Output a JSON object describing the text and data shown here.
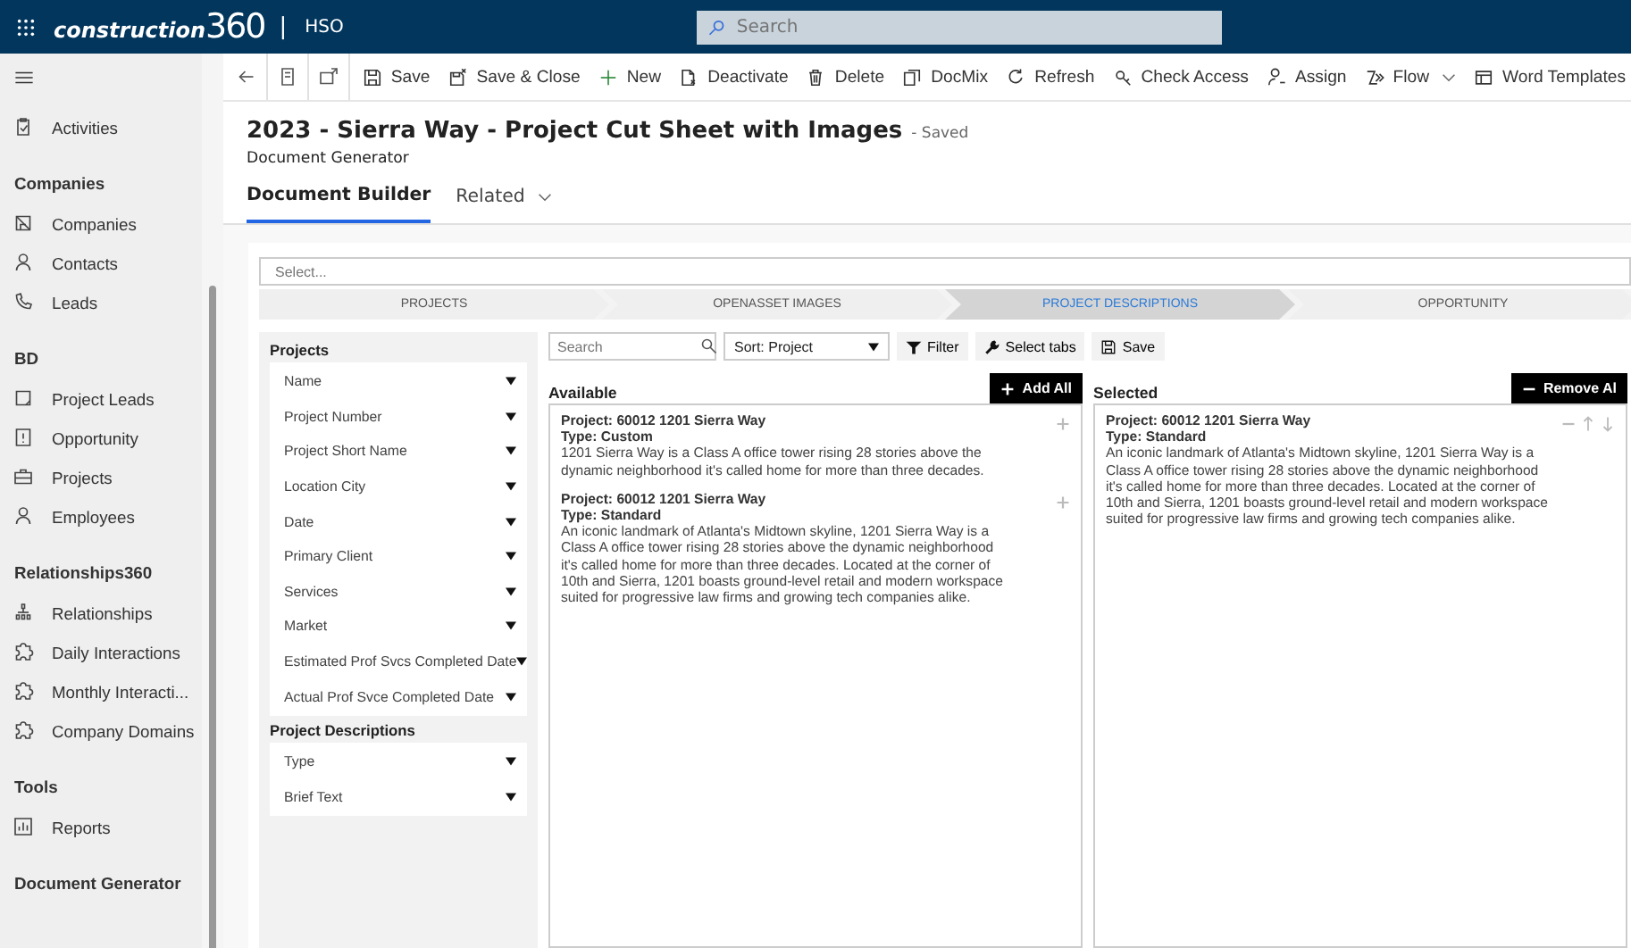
{
  "top_bar": {
    "logo": "construction",
    "logo_number": "360",
    "separator": "|",
    "org": "HSO",
    "search": {
      "placeholder": "Search"
    }
  },
  "sidebar": {
    "items": [
      {
        "label": "Activities",
        "kind": "clipboard"
      }
    ],
    "groups": [
      {
        "title": "Companies",
        "items": [
          {
            "label": "Companies",
            "kind": "building"
          },
          {
            "label": "Contacts",
            "kind": "person"
          },
          {
            "label": "Leads",
            "kind": "phone"
          }
        ]
      },
      {
        "title": "BD",
        "items": [
          {
            "label": "Project Leads",
            "kind": "notepad"
          },
          {
            "label": "Opportunity",
            "kind": "alert"
          },
          {
            "label": "Projects",
            "kind": "briefcase"
          },
          {
            "label": "Employees",
            "kind": "person"
          }
        ]
      },
      {
        "title": "Relationships360",
        "items": [
          {
            "label": "Relationships",
            "kind": "orgchart"
          },
          {
            "label": "Daily Interactions",
            "kind": "puzzle"
          },
          {
            "label": "Monthly Interacti...",
            "kind": "puzzle"
          },
          {
            "label": "Company Domains",
            "kind": "puzzle"
          }
        ]
      },
      {
        "title": "Tools",
        "items": [
          {
            "label": "Reports",
            "kind": "chart"
          }
        ]
      },
      {
        "title": "Document Generator"
      }
    ]
  },
  "command_bar": {
    "nav": [
      {
        "kind": "back"
      },
      {
        "kind": "page"
      },
      {
        "kind": "popout"
      }
    ],
    "items": [
      {
        "label": "Save",
        "kind": "save"
      },
      {
        "label": "Save & Close",
        "kind": "saveclose"
      },
      {
        "label": "New",
        "kind": "new"
      },
      {
        "label": "Deactivate",
        "kind": "deactivate"
      },
      {
        "label": "Delete",
        "kind": "delete"
      },
      {
        "label": "DocMix",
        "kind": "docmix"
      },
      {
        "label": "Refresh",
        "kind": "refresh"
      },
      {
        "label": "Check Access",
        "kind": "key"
      },
      {
        "label": "Assign",
        "kind": "assign"
      },
      {
        "label": "Flow",
        "kind": "flow",
        "dropdown": true
      },
      {
        "label": "Word Templates",
        "kind": "template"
      }
    ]
  },
  "header": {
    "title": "2023 - Sierra Way - Project Cut Sheet with Images",
    "status": "- Saved",
    "subtitle": "Document Generator",
    "tabs": [
      {
        "label": "Document Builder",
        "selected": true,
        "dropdown": false
      },
      {
        "label": "Related",
        "selected": false,
        "dropdown": true
      }
    ]
  },
  "builder": {
    "select": {
      "placeholder": "Select..."
    },
    "steps": [
      {
        "label": "PROJECTS",
        "selected": false
      },
      {
        "label": "OPENASSET IMAGES",
        "selected": false
      },
      {
        "label": "PROJECT DESCRIPTIONS",
        "selected": true
      },
      {
        "label": "OPPORTUNITY",
        "selected": false
      }
    ],
    "field_groups": [
      {
        "title": "Projects",
        "fields": [
          "Name",
          "Project Number",
          "Project Short Name",
          "Location City",
          "Date",
          "Primary Client",
          "Services",
          "Market",
          "Estimated Prof Svcs Completed Date",
          "Actual Prof Svce Completed Date"
        ]
      },
      {
        "title": "Project Descriptions",
        "fields": [
          "Type",
          "Brief Text"
        ]
      }
    ],
    "search": {
      "placeholder": "Search"
    },
    "sort": "Sort: Project",
    "tools": [
      {
        "label": "Filter",
        "kind": "filter"
      },
      {
        "label": "Select tabs",
        "kind": "wrench"
      },
      {
        "label": "Save",
        "kind": "save"
      }
    ],
    "available": {
      "title": "Available",
      "action": "Add All",
      "items": [
        {
          "project": "Project: 60012 1201 Sierra Way",
          "type": "Type: Custom",
          "text": "1201 Sierra Way is a Class A office tower rising 28 stories above the dynamic neighborhood it's called home for more than three decades."
        },
        {
          "project": "Project: 60012 1201 Sierra Way",
          "type": "Type: Standard",
          "text": "An iconic landmark of Atlanta's Midtown skyline, 1201 Sierra Way is a Class A office tower rising 28 stories above the dynamic neighborhood it's called home for more than three decades. Located at the corner of 10th and Sierra, 1201 boasts ground-level retail and modern workspace suited for progressive law firms and growing tech companies alike."
        }
      ]
    },
    "selected": {
      "title": "Selected",
      "action": "Remove Al",
      "items": [
        {
          "project": "Project: 60012 1201 Sierra Way",
          "type": "Type: Standard",
          "text": "An iconic landmark of Atlanta's Midtown skyline, 1201 Sierra Way is a Class A office tower rising 28 stories above the dynamic neighborhood it's called home for more than three decades. Located at the corner of 10th and Sierra, 1201 boasts ground-level retail and modern workspace suited for progressive law firms and growing tech companies alike."
        }
      ]
    }
  }
}
